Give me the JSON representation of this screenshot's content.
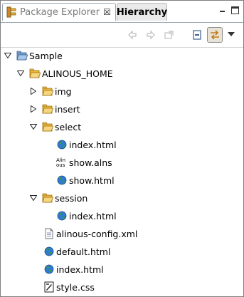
{
  "tabs": [
    {
      "label": "Package Explorer",
      "icon": "package-explorer-icon",
      "close": "☒"
    },
    {
      "label": "Hierarchy"
    }
  ],
  "toolbar": {
    "back_icon": "back-arrow-icon",
    "forward_icon": "forward-arrow-icon",
    "up_icon": "go-into-icon",
    "collapse_icon": "collapse-all-icon",
    "link_icon": "link-with-editor-icon",
    "menu_icon": "view-menu-icon"
  },
  "tree": {
    "project": {
      "label": "Sample",
      "expanded": true
    },
    "alinous_home": {
      "label": "ALINOUS_HOME",
      "expanded": true
    },
    "img": {
      "label": "img",
      "expanded": false
    },
    "insert": {
      "label": "insert",
      "expanded": false
    },
    "select": {
      "label": "select",
      "expanded": true
    },
    "select_index": {
      "label": "index.html"
    },
    "select_show_alns": {
      "label": "show.alns"
    },
    "select_show_html": {
      "label": "show.html"
    },
    "session": {
      "label": "session",
      "expanded": true
    },
    "session_index": {
      "label": "index.html"
    },
    "config": {
      "label": "alinous-config.xml"
    },
    "default_html": {
      "label": "default.html"
    },
    "index_html": {
      "label": "index.html"
    },
    "style_css": {
      "label": "style.css"
    }
  },
  "icon_text": {
    "alns": "Alin ous"
  },
  "colors": {
    "folder": "#e8b63a",
    "folder_dark": "#b27d14",
    "project_folder": "#6f9fd0",
    "globe": "#2f7bd0",
    "globe_land": "#3a9a3a",
    "tab_border": "#9aa6b4",
    "link_button_bg": "#e8e3d6"
  }
}
